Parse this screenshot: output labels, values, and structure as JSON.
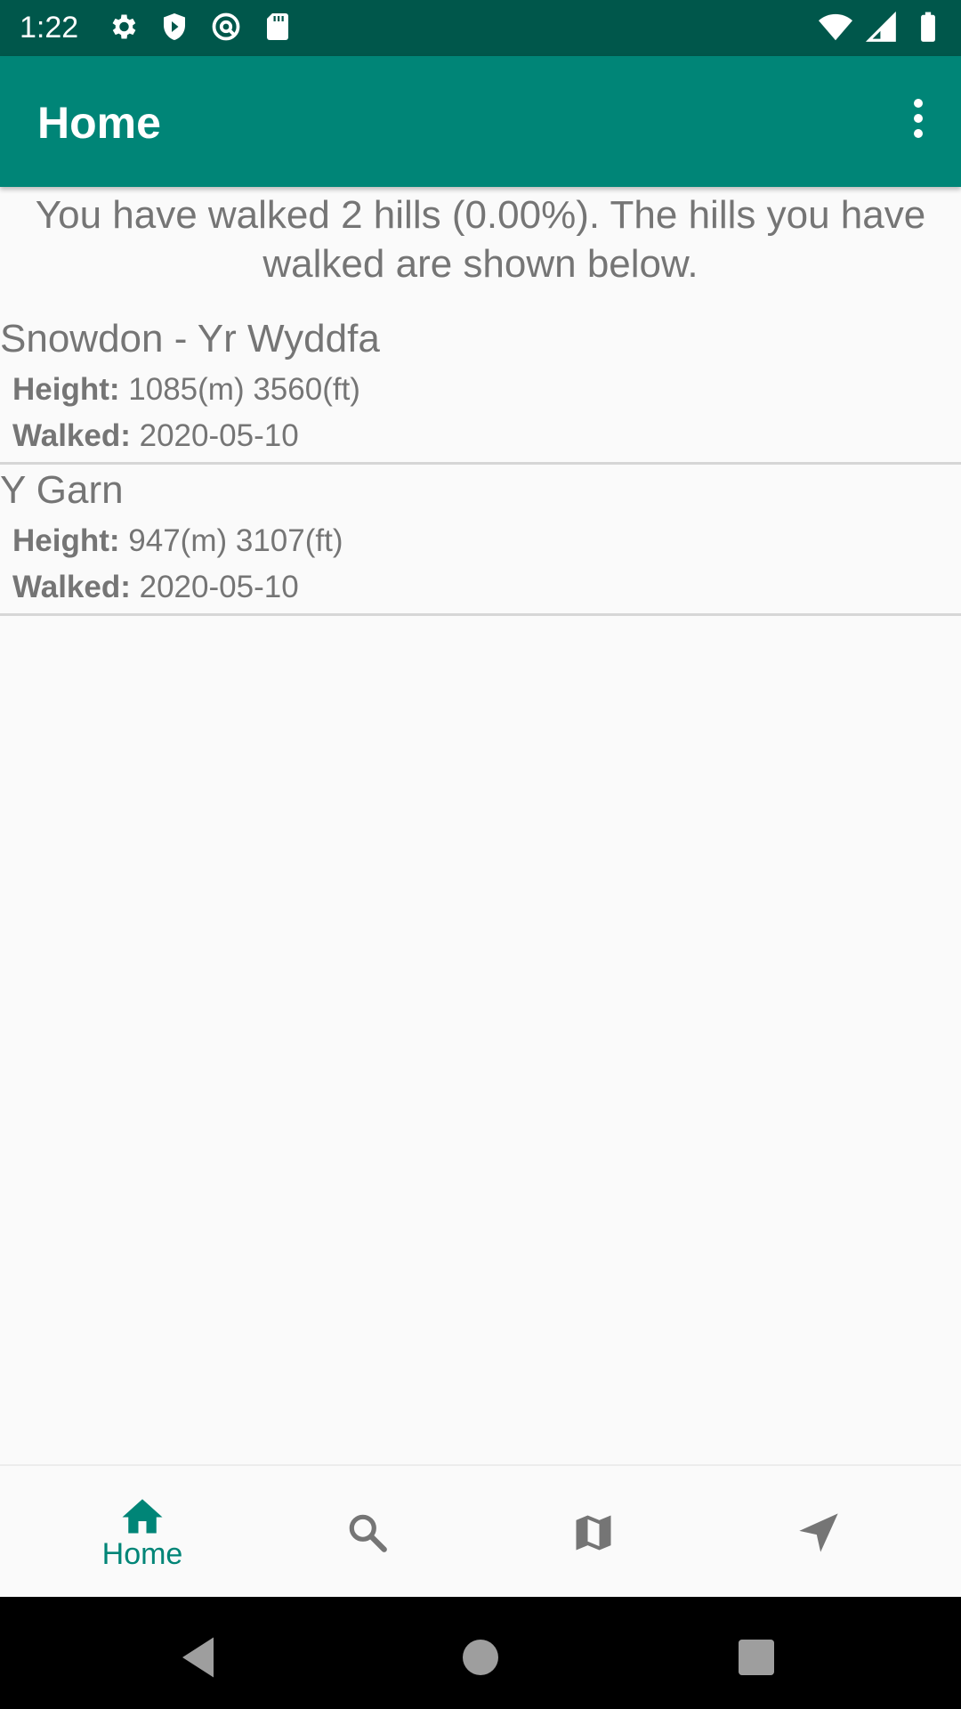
{
  "status_bar": {
    "time": "1:22",
    "left_icons": [
      "gear-icon",
      "shield-icon",
      "at-sign-icon",
      "sd-card-icon"
    ],
    "right_icons": [
      "wifi-icon",
      "signal-icon",
      "battery-icon"
    ]
  },
  "app_bar": {
    "title": "Home",
    "menu_icon": "more-vert-icon",
    "color": "#008577"
  },
  "summary": {
    "text": "You have walked  2 hills (0.00%). The hills you have walked are shown below."
  },
  "hills": [
    {
      "name": "Snowdon - Yr Wyddfa",
      "height_label": "Height:",
      "height_value": "1085(m) 3560(ft)",
      "walked_label": "Walked:",
      "walked_value": "2020-05-10"
    },
    {
      "name": "Y Garn",
      "height_label": "Height:",
      "height_value": "947(m) 3107(ft)",
      "walked_label": "Walked:",
      "walked_value": "2020-05-10"
    }
  ],
  "bottom_nav": {
    "items": [
      {
        "label": "Home",
        "icon": "home-icon",
        "active": true
      },
      {
        "label": "",
        "icon": "search-icon",
        "active": false
      },
      {
        "label": "",
        "icon": "map-icon",
        "active": false
      },
      {
        "label": "",
        "icon": "navigation-icon",
        "active": false
      }
    ],
    "active_color": "#008577",
    "inactive_color": "#757575"
  },
  "system_nav": {
    "buttons": [
      "back-icon",
      "home-circle-icon",
      "recents-icon"
    ]
  }
}
